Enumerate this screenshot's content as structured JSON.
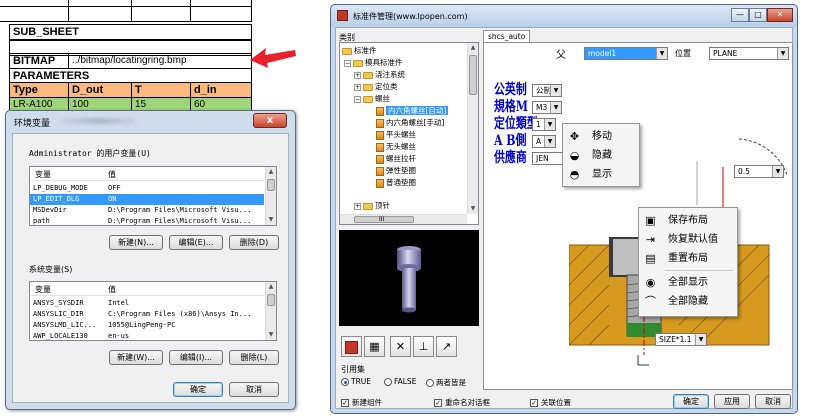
{
  "sheet": {
    "sub_sheet": "SUB_SHEET",
    "bitmap_label": "BITMAP",
    "bitmap_path": "../bitmap/locatingring.bmp",
    "parameters": "PARAMETERS",
    "headers": [
      "Type",
      "D_out",
      "T",
      "d_in"
    ],
    "partial_row": [
      "LR-A100",
      "100",
      "15",
      "60"
    ]
  },
  "env_dialog": {
    "title": "环境变量",
    "close_glyph": "x",
    "user_group_label": "Administrator 的用户变量(U)",
    "col_var": "变量",
    "col_value": "值",
    "user_vars": [
      {
        "name": "LP_DEBUG_MODE",
        "value": "OFF"
      },
      {
        "name": "LP_EDIT_DLG",
        "value": "ON"
      },
      {
        "name": "MSDevDir",
        "value": "D:\\Program Files\\Microsoft Visu..."
      },
      {
        "name": "path",
        "value": "D:\\Program Files\\Microsoft Visu..."
      }
    ],
    "sys_group_label": "系统变量(S)",
    "sys_vars": [
      {
        "name": "ANSYS_SYSDIR",
        "value": "Intel"
      },
      {
        "name": "ANSYSLIC_DIR",
        "value": "C:\\Program Files (x86)\\Ansys In..."
      },
      {
        "name": "ANSYSLMD_LIC...",
        "value": "1055@LingPeng-PC"
      },
      {
        "name": "AWP_LOCALE130",
        "value": "en-us"
      }
    ],
    "btn_new": "新建(N)...",
    "btn_edit": "编辑(E)...",
    "btn_delete": "删除(D)",
    "btn_new2": "新建(W)...",
    "btn_edit2": "编辑(I)...",
    "btn_delete2": "删除(L)",
    "btn_ok": "确定",
    "btn_cancel": "取消"
  },
  "main_window": {
    "title": "标准件管理(www.lpopen.com)",
    "win_min": "—",
    "win_max": "□",
    "win_close": "✕",
    "category_label": "类别",
    "tree": [
      {
        "text": "标准件",
        "type": "folder",
        "exp": ""
      },
      {
        "text": "模具标准件",
        "type": "folder",
        "exp": "−"
      },
      {
        "text": "浇注系统",
        "type": "folder",
        "exp": "+"
      },
      {
        "text": "定位类",
        "type": "folder",
        "exp": "+"
      },
      {
        "text": "螺丝",
        "type": "folder",
        "exp": "−"
      },
      {
        "text": "内六角螺丝[自动]",
        "type": "part",
        "exp": "",
        "selected": true
      },
      {
        "text": "内六角螺丝[手动]",
        "type": "part",
        "exp": ""
      },
      {
        "text": "平头螺丝",
        "type": "part",
        "exp": ""
      },
      {
        "text": "无头螺丝",
        "type": "part",
        "exp": ""
      },
      {
        "text": "螺丝拉杆",
        "type": "part",
        "exp": ""
      },
      {
        "text": "弹性垫圈",
        "type": "part",
        "exp": ""
      },
      {
        "text": "普通垫圈",
        "type": "part",
        "exp": ""
      },
      {
        "text": "顶针",
        "type": "folder",
        "exp": "+"
      }
    ],
    "hscroll_glyph": "III",
    "tab_label": "shcs_auto",
    "parent_symbol": "父",
    "model_value": "model1",
    "position_label": "位置",
    "position_value": "PLANE",
    "params": [
      {
        "label": "公英制",
        "value": "公制"
      },
      {
        "label": "規格M",
        "value": "M3"
      },
      {
        "label": "定位類型",
        "value": "1"
      },
      {
        "label": "A B側",
        "value": "A"
      },
      {
        "label": "供應商",
        "value": "JEN"
      }
    ],
    "ctx_menu1": [
      {
        "icon": "move-icon",
        "glyph": "✥",
        "label": "移动"
      },
      {
        "icon": "hide-icon",
        "glyph": "◒",
        "label": "隐藏"
      },
      {
        "icon": "show-icon",
        "glyph": "◓",
        "label": "显示"
      }
    ],
    "ctx_menu2": [
      {
        "icon": "save-layout-icon",
        "glyph": "▣",
        "label": "保存布局"
      },
      {
        "icon": "restore-default-icon",
        "glyph": "⇥",
        "label": "恢复默认值"
      },
      {
        "icon": "reset-layout-icon",
        "glyph": "▤",
        "label": "重置布局"
      },
      {
        "icon": "show-all-icon",
        "glyph": "◉",
        "label": "全部显示"
      },
      {
        "icon": "hide-all-icon",
        "glyph": "⌒",
        "label": "全部隐藏"
      }
    ],
    "dim_value": "0.5",
    "size_value": "SIZE*1.1",
    "ref_label": "引用集",
    "radio_true": "TRUE",
    "radio_false": "FALSE",
    "radio_both": "两者皆是",
    "chk_new": "新建组件",
    "chk_rename": "重命名对话框",
    "chk_link": "关联位置",
    "btn_ok": "确定",
    "btn_apply": "应用",
    "btn_cancel": "取消"
  },
  "colors": {
    "selection": "#3399ff",
    "param_label": "#0000c8",
    "arrow": "#e8212b"
  }
}
